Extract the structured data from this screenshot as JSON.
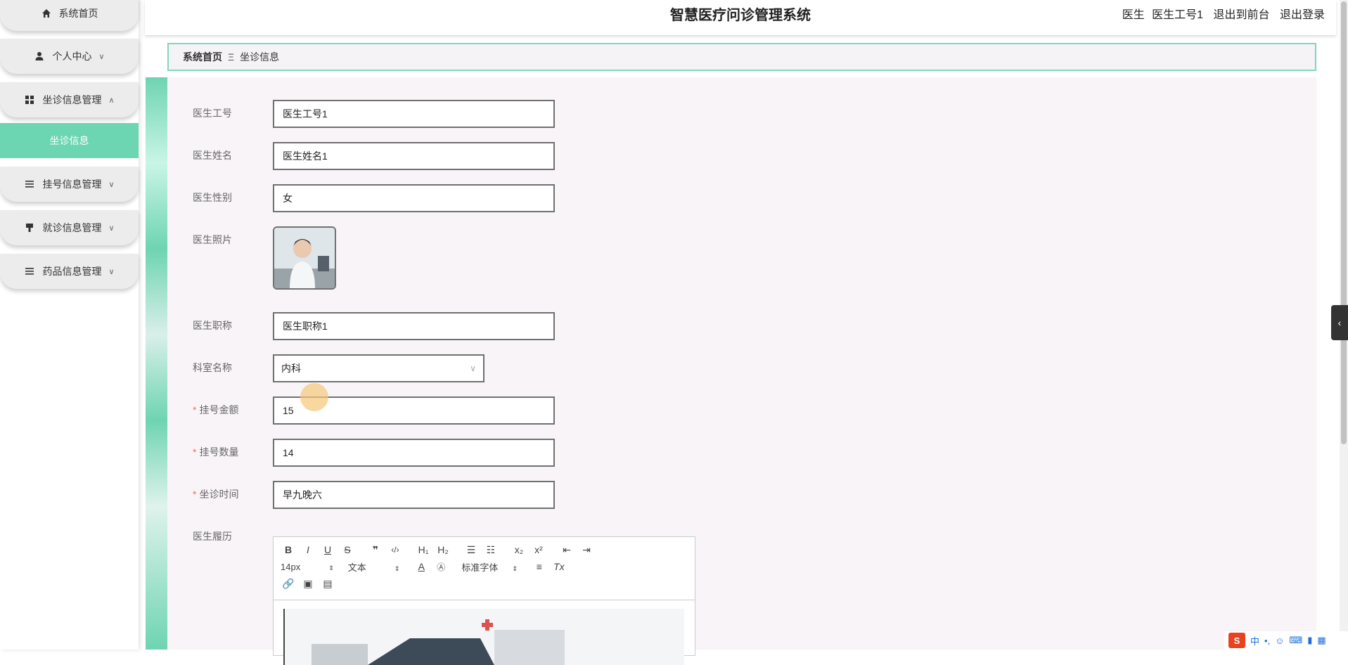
{
  "sidebar": {
    "items": [
      {
        "label": "系统首页",
        "icon": "home-icon"
      },
      {
        "label": "个人中心",
        "icon": "user-icon"
      },
      {
        "label": "坐诊信息管理",
        "icon": "grid-icon"
      },
      {
        "label": "挂号信息管理",
        "icon": "list-icon"
      },
      {
        "label": "就诊信息管理",
        "icon": "brush-icon"
      },
      {
        "label": "药品信息管理",
        "icon": "list-icon"
      }
    ],
    "active_sub": "坐诊信息"
  },
  "header": {
    "title": "智慧医疗问诊管理系统",
    "role": "医生",
    "username": "医生工号1",
    "to_front": "退出到前台",
    "logout": "退出登录"
  },
  "breadcrumb": {
    "home": "系统首页",
    "separator": "Ξ",
    "current": "坐诊信息"
  },
  "form": {
    "doctor_id_label": "医生工号",
    "doctor_id": "医生工号1",
    "doctor_name_label": "医生姓名",
    "doctor_name": "医生姓名1",
    "gender_label": "医生性别",
    "gender": "女",
    "photo_label": "医生照片",
    "title_label": "医生职称",
    "title": "医生职称1",
    "dept_label": "科室名称",
    "dept": "内科",
    "fee_label": "挂号金额",
    "fee": "15",
    "quota_label": "挂号数量",
    "quota": "14",
    "time_label": "坐诊时间",
    "time": "早九晚六",
    "resume_label": "医生履历",
    "required_mark": "*"
  },
  "editor": {
    "font_size": "14px",
    "text_type": "文本",
    "font_family": "标准字体"
  },
  "ime": {
    "mode": "中"
  },
  "colors": {
    "accent": "#6cd5b1",
    "breadcrumb_border": "#7fd8bd",
    "required": "#f56c6c"
  }
}
